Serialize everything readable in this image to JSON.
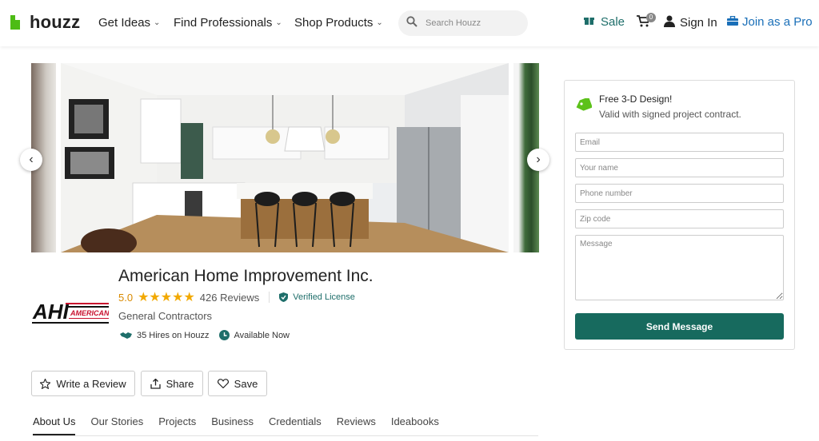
{
  "header": {
    "logo_text": "houzz",
    "nav": [
      {
        "label": "Get Ideas"
      },
      {
        "label": "Find Professionals"
      },
      {
        "label": "Shop Products"
      }
    ],
    "search_placeholder": "Search Houzz",
    "sale_label": "Sale",
    "cart_count": "0",
    "signin_label": "Sign In",
    "join_label": "Join as a Pro",
    "colors": {
      "brand_green": "#4dbc15",
      "teal": "#1e6e6a",
      "blue": "#1a6fb8"
    }
  },
  "profile": {
    "name": "American Home Improvement Inc.",
    "rating": "5.0",
    "stars": "★★★★★",
    "reviews": "426 Reviews",
    "verified": "Verified License",
    "category": "General Contractors",
    "hires": "35 Hires on Houzz",
    "availability": "Available Now",
    "logo_text": "AHI",
    "logo_sub": "AMERICAN"
  },
  "actions": {
    "review": "Write a Review",
    "share": "Share",
    "save": "Save"
  },
  "tabs": [
    {
      "label": "About Us"
    },
    {
      "label": "Our Stories"
    },
    {
      "label": "Projects"
    },
    {
      "label": "Business"
    },
    {
      "label": "Credentials"
    },
    {
      "label": "Reviews"
    },
    {
      "label": "Ideabooks"
    }
  ],
  "contact": {
    "promo_title": "Free 3-D Design!",
    "promo_sub": "Valid with signed project contract.",
    "email_placeholder": "Email",
    "name_placeholder": "Your name",
    "phone_placeholder": "Phone number",
    "zip_placeholder": "Zip code",
    "message_placeholder": "Message",
    "send_label": "Send Message"
  }
}
